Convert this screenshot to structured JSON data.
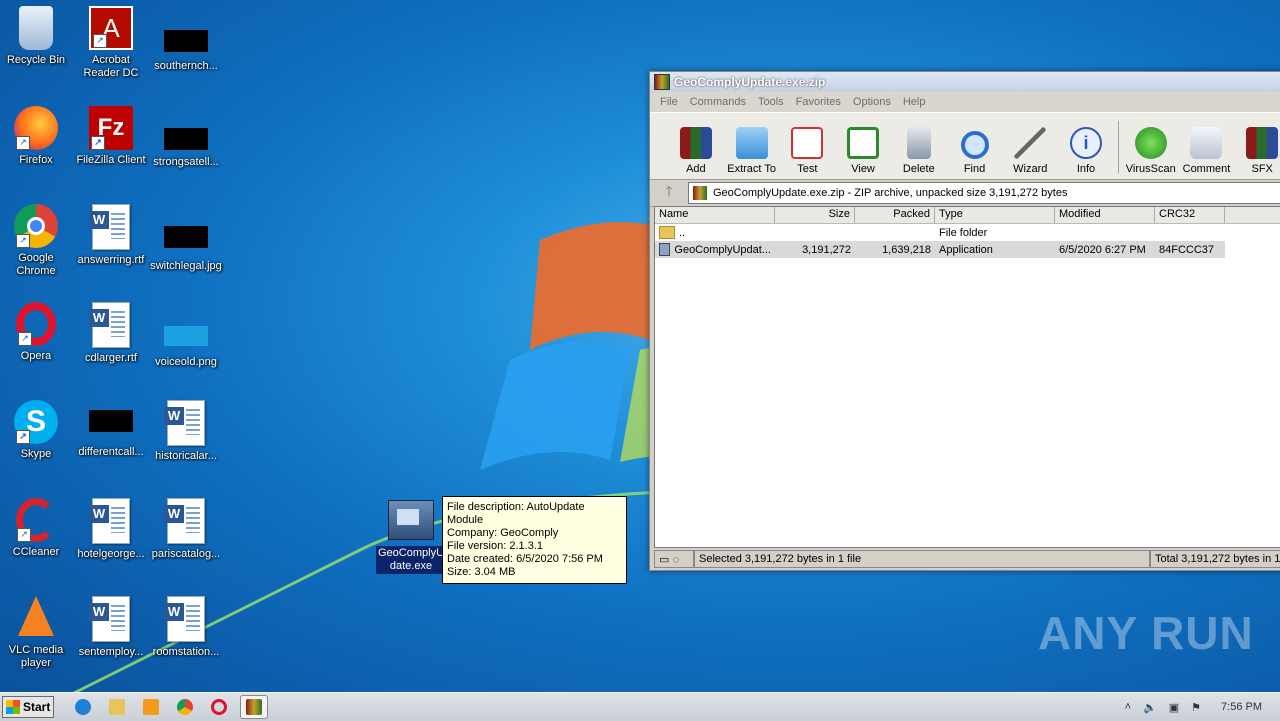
{
  "desktop": {
    "icons": [
      {
        "label": "Recycle Bin"
      },
      {
        "label": "Acrobat Reader DC"
      },
      {
        "label": "southernch..."
      },
      {
        "label": "Firefox"
      },
      {
        "label": "FileZilla Client"
      },
      {
        "label": "strongsatell..."
      },
      {
        "label": "Google Chrome"
      },
      {
        "label": "answerring.rtf"
      },
      {
        "label": "switchlegal.jpg"
      },
      {
        "label": "Opera"
      },
      {
        "label": "cdlarger.rtf"
      },
      {
        "label": "voiceold.png"
      },
      {
        "label": "Skype"
      },
      {
        "label": "differentcall..."
      },
      {
        "label": "historicalar..."
      },
      {
        "label": "CCleaner"
      },
      {
        "label": "hotelgeorge..."
      },
      {
        "label": "pariscatalog..."
      },
      {
        "label": "VLC media player"
      },
      {
        "label": "sentemploy..."
      },
      {
        "label": "roomstation..."
      }
    ],
    "selected_file": {
      "label_line1": "GeoComplyUp",
      "label_line2": "date.exe"
    },
    "tooltip": {
      "description": "File description: AutoUpdate Module",
      "company": "Company: GeoComply",
      "version": "File version: 2.1.3.1",
      "created": "Date created: 6/5/2020 7:56 PM",
      "size": "Size: 3.04 MB"
    }
  },
  "winrar": {
    "title": "GeoComplyUpdate.exe.zip",
    "menu": [
      "File",
      "Commands",
      "Tools",
      "Favorites",
      "Options",
      "Help"
    ],
    "toolbar": [
      "Add",
      "Extract To",
      "Test",
      "View",
      "Delete",
      "Find",
      "Wizard",
      "Info",
      "VirusScan",
      "Comment",
      "SFX"
    ],
    "address": "GeoComplyUpdate.exe.zip - ZIP archive, unpacked size 3,191,272 bytes",
    "columns": [
      "Name",
      "Size",
      "Packed",
      "Type",
      "Modified",
      "CRC32"
    ],
    "rows": [
      {
        "name": "..",
        "size": "",
        "packed": "",
        "type": "File folder",
        "modified": "",
        "crc": ""
      },
      {
        "name": "GeoComplyUpdat...",
        "size": "3,191,272",
        "packed": "1,639,218",
        "type": "Application",
        "modified": "6/5/2020 6:27 PM",
        "crc": "84FCCC37"
      }
    ],
    "status_left": "Selected 3,191,272 bytes in 1 file",
    "status_right": "Total 3,191,272 bytes in 1"
  },
  "taskbar": {
    "start_label": "Start",
    "clock": "7:56 PM"
  },
  "watermark": "ANY RUN"
}
